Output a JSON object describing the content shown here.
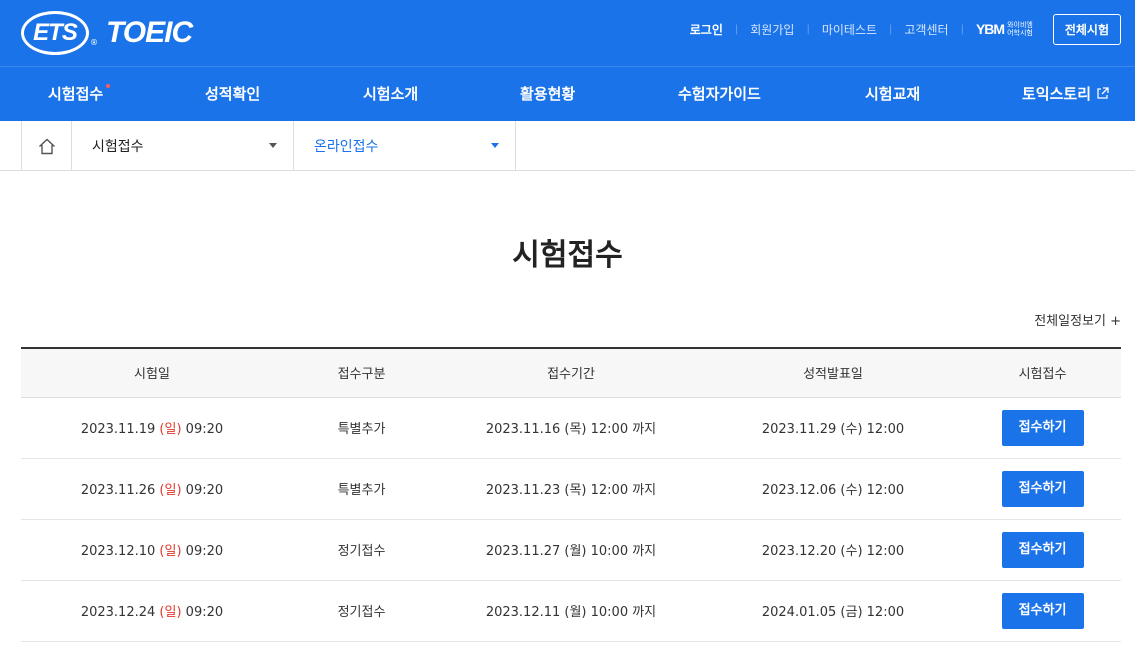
{
  "brand": {
    "ets": "ETS",
    "reg": "®",
    "toeic": "TOEIC"
  },
  "util": {
    "login": "로그인",
    "signup": "회원가입",
    "mytest": "마이테스트",
    "support": "고객센터",
    "ybm_mark": "YBM",
    "ybm_sub1": "와이비엠",
    "ybm_sub2": "어학시험",
    "all_tests": "전체시험"
  },
  "gnb": {
    "items": [
      "시험접수",
      "성적확인",
      "시험소개",
      "활용현황",
      "수험자가이드",
      "시험교재",
      "토익스토리"
    ]
  },
  "lnb": {
    "depth1": "시험접수",
    "depth2": "온라인접수"
  },
  "page_title": "시험접수",
  "more_link": "전체일정보기 +",
  "table": {
    "headers": [
      "시험일",
      "접수구분",
      "접수기간",
      "성적발표일",
      "시험접수"
    ],
    "rows": [
      {
        "date": "2023.11.19",
        "day": "(일)",
        "time": "09:20",
        "type": "특별추가",
        "period": "2023.11.16 (목) 12:00 까지",
        "result": "2023.11.29 (수) 12:00",
        "btn": "접수하기"
      },
      {
        "date": "2023.11.26",
        "day": "(일)",
        "time": "09:20",
        "type": "특별추가",
        "period": "2023.11.23 (목) 12:00 까지",
        "result": "2023.12.06 (수) 12:00",
        "btn": "접수하기"
      },
      {
        "date": "2023.12.10",
        "day": "(일)",
        "time": "09:20",
        "type": "정기접수",
        "period": "2023.11.27 (월) 10:00 까지",
        "result": "2023.12.20 (수) 12:00",
        "btn": "접수하기"
      },
      {
        "date": "2023.12.24",
        "day": "(일)",
        "time": "09:20",
        "type": "정기접수",
        "period": "2023.12.11 (월) 10:00 까지",
        "result": "2024.01.05 (금) 12:00",
        "btn": "접수하기"
      }
    ]
  },
  "colors": {
    "primary": "#1a73e8",
    "sunday": "#e0392b"
  }
}
